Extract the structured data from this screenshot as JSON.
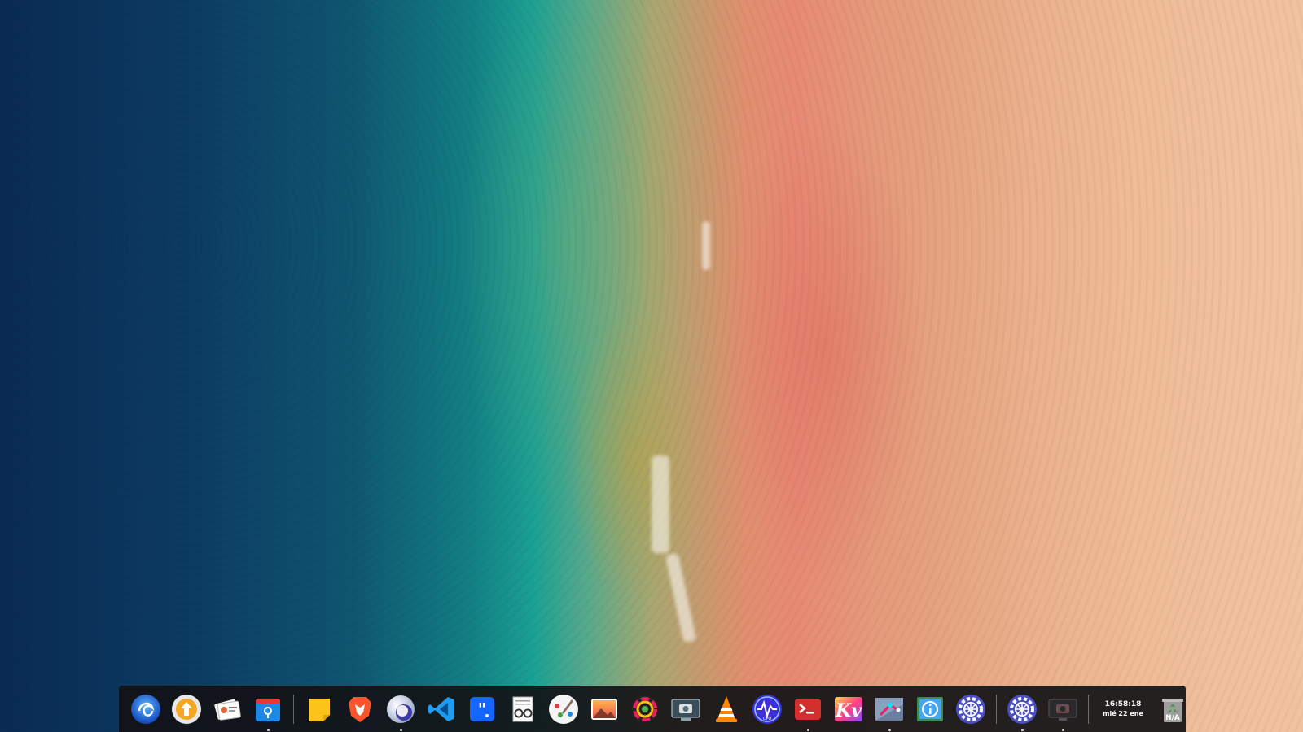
{
  "desktop": {
    "wallpaper": "aerial-beach-ocean-sand"
  },
  "dock": {
    "apps": [
      {
        "icon": "launcher-icon",
        "running": false
      },
      {
        "icon": "software-update-icon",
        "running": false
      },
      {
        "icon": "contacts-card-icon",
        "running": false
      },
      {
        "icon": "app-store-icon",
        "running": true
      },
      {
        "icon": "sticky-notes-icon",
        "running": false
      },
      {
        "icon": "brave-browser-icon",
        "running": false
      },
      {
        "icon": "planet-browser-icon",
        "running": true
      },
      {
        "icon": "vscode-icon",
        "running": false
      },
      {
        "icon": "quotes-app-icon",
        "running": false
      },
      {
        "icon": "document-viewer-icon",
        "running": false
      },
      {
        "icon": "paint-app-icon",
        "running": false
      },
      {
        "icon": "photo-viewer-icon",
        "running": false
      },
      {
        "icon": "color-picker-icon",
        "running": false
      },
      {
        "icon": "screenshot-icon",
        "running": false
      },
      {
        "icon": "vlc-icon",
        "running": false
      },
      {
        "icon": "cpu-monitor-icon",
        "running": false
      },
      {
        "icon": "terminal-icon",
        "running": true
      },
      {
        "icon": "kivy-icon",
        "running": false
      },
      {
        "icon": "git-tool-icon",
        "running": true
      },
      {
        "icon": "system-info-icon",
        "running": false
      },
      {
        "icon": "settings-gear-icon",
        "running": false
      },
      {
        "icon": "settings-gear-running-icon",
        "running": true
      },
      {
        "icon": "screen-recorder-icon",
        "running": true
      }
    ],
    "clock": {
      "time": "16:58:18",
      "date": "mié 22 ene"
    },
    "trash": {
      "label": "N/A"
    },
    "colors": {
      "background": "#121216",
      "separator": "#8a8a8a"
    }
  }
}
